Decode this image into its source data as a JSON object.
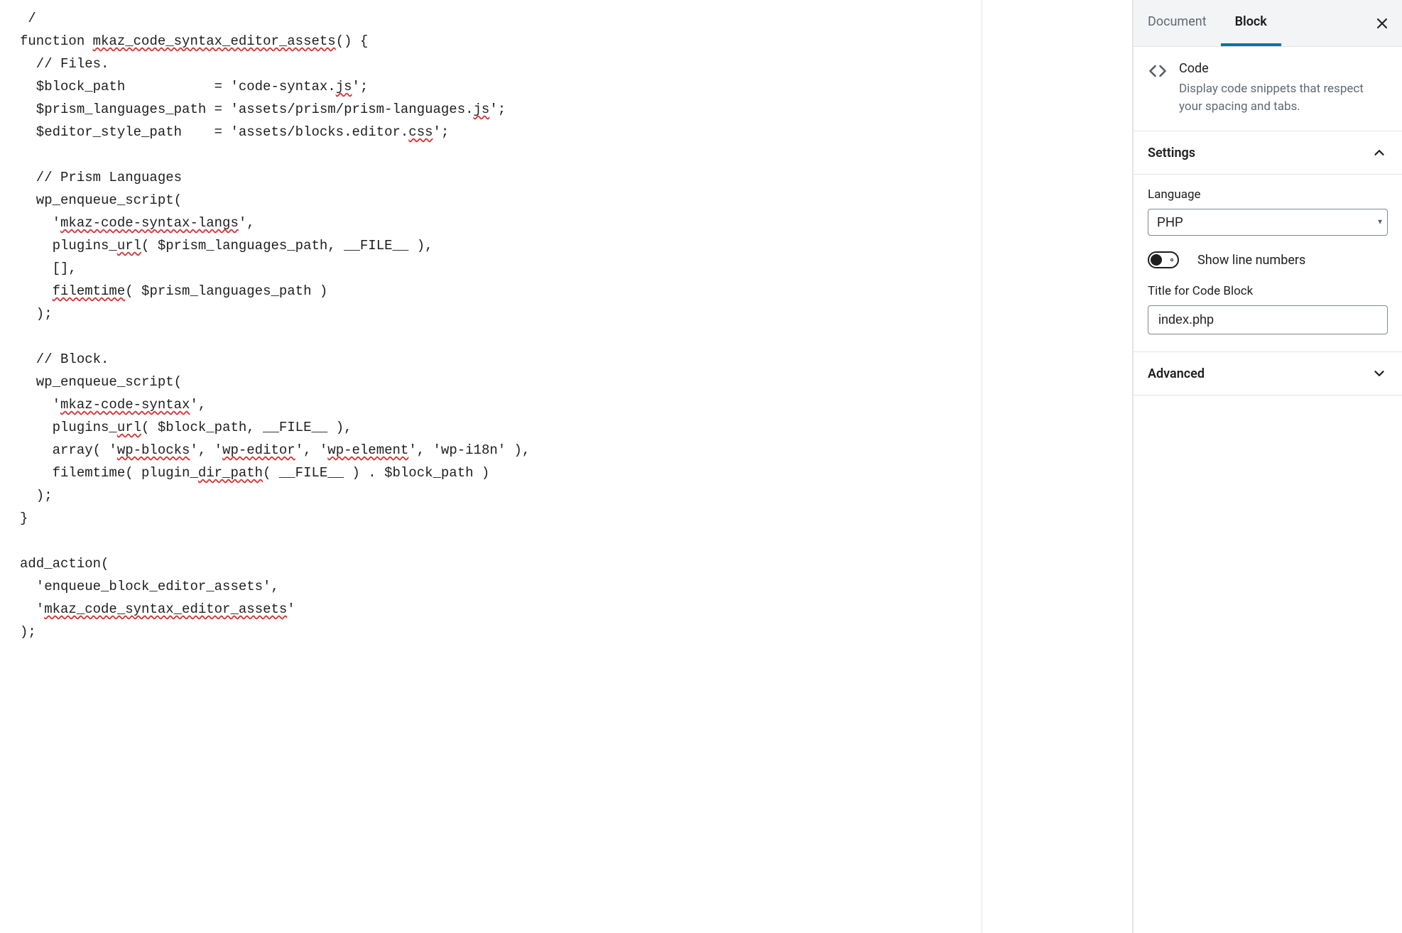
{
  "code": {
    "lines": [
      {
        "indent": 0,
        "text": " /",
        "spellwords": []
      },
      {
        "indent": 0,
        "text": "function mkaz_code_syntax_editor_assets() {",
        "spellwords": [
          "mkaz_code_syntax_editor_assets"
        ]
      },
      {
        "indent": 1,
        "text": "// Files.",
        "spellwords": []
      },
      {
        "indent": 1,
        "text": "$block_path           = 'code-syntax.js';",
        "spellwords": [
          "js"
        ]
      },
      {
        "indent": 1,
        "text": "$prism_languages_path = 'assets/prism/prism-languages.js';",
        "spellwords": [
          "js"
        ]
      },
      {
        "indent": 1,
        "text": "$editor_style_path    = 'assets/blocks.editor.css';",
        "spellwords": [
          "css"
        ]
      },
      {
        "indent": 0,
        "text": "",
        "spellwords": []
      },
      {
        "indent": 1,
        "text": "// Prism Languages",
        "spellwords": []
      },
      {
        "indent": 1,
        "text": "wp_enqueue_script(",
        "spellwords": []
      },
      {
        "indent": 2,
        "text": "'mkaz-code-syntax-langs',",
        "spellwords": [
          "mkaz-code-syntax-langs"
        ]
      },
      {
        "indent": 2,
        "text": "plugins_url( $prism_languages_path, __FILE__ ),",
        "spellwords": [
          "url"
        ]
      },
      {
        "indent": 2,
        "text": "[],",
        "spellwords": []
      },
      {
        "indent": 2,
        "text": "filemtime( $prism_languages_path )",
        "spellwords": [
          "filemtime"
        ]
      },
      {
        "indent": 1,
        "text": ");",
        "spellwords": []
      },
      {
        "indent": 0,
        "text": "",
        "spellwords": []
      },
      {
        "indent": 1,
        "text": "// Block.",
        "spellwords": []
      },
      {
        "indent": 1,
        "text": "wp_enqueue_script(",
        "spellwords": []
      },
      {
        "indent": 2,
        "text": "'mkaz-code-syntax',",
        "spellwords": [
          "mkaz-code-syntax"
        ]
      },
      {
        "indent": 2,
        "text": "plugins_url( $block_path, __FILE__ ),",
        "spellwords": [
          "url"
        ]
      },
      {
        "indent": 2,
        "text": "array( 'wp-blocks', 'wp-editor', 'wp-element', 'wp-i18n' ),",
        "spellwords": [
          "wp-blocks",
          "wp-editor",
          "wp-element"
        ]
      },
      {
        "indent": 2,
        "text": "filemtime( plugin_dir_path( __FILE__ ) . $block_path )",
        "spellwords": [
          "dir_path"
        ]
      },
      {
        "indent": 1,
        "text": ");",
        "spellwords": []
      },
      {
        "indent": 0,
        "text": "}",
        "spellwords": []
      },
      {
        "indent": 0,
        "text": "",
        "spellwords": []
      },
      {
        "indent": 0,
        "text": "add_action(",
        "spellwords": []
      },
      {
        "indent": 1,
        "text": "'enqueue_block_editor_assets',",
        "spellwords": []
      },
      {
        "indent": 1,
        "text": "'mkaz_code_syntax_editor_assets'",
        "spellwords": [
          "mkaz_code_syntax_editor_assets"
        ]
      },
      {
        "indent": 0,
        "text": ");",
        "spellwords": []
      }
    ]
  },
  "sidebar": {
    "tabs": {
      "document": "Document",
      "block": "Block"
    },
    "block_card": {
      "title": "Code",
      "description": "Display code snippets that respect your spacing and tabs."
    },
    "settings": {
      "title": "Settings",
      "language_label": "Language",
      "language_value": "PHP",
      "line_numbers_label": "Show line numbers",
      "line_numbers_on": false,
      "title_label": "Title for Code Block",
      "title_value": "index.php"
    },
    "advanced": {
      "title": "Advanced"
    }
  }
}
